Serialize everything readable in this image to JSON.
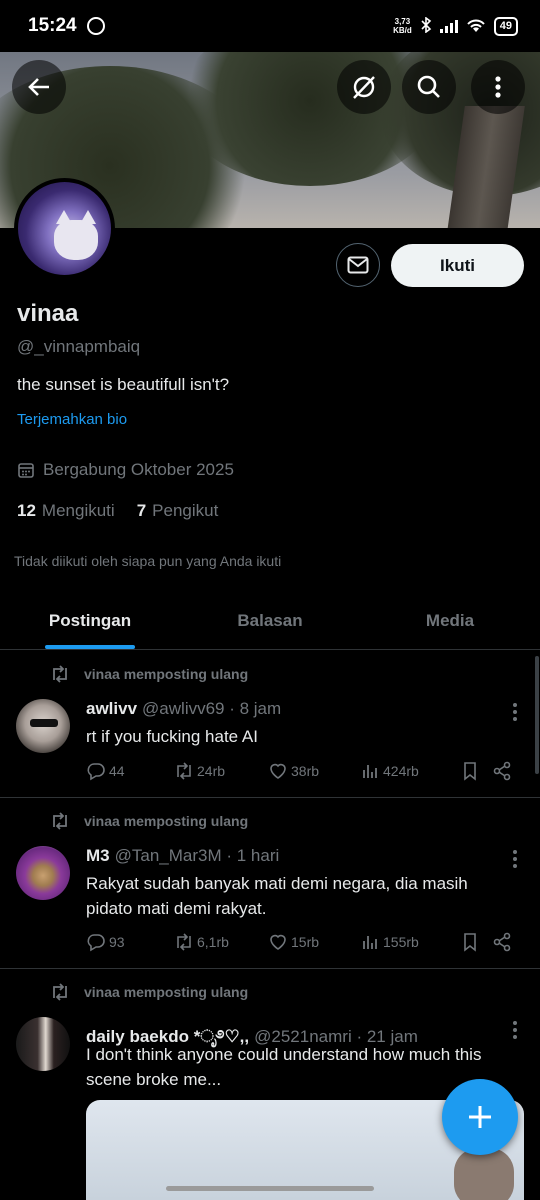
{
  "status_bar": {
    "time": "15:24",
    "speed_value": "3,73",
    "speed_unit": "KB/d",
    "battery": "49"
  },
  "profile": {
    "name": "vinaa",
    "handle": "@_vinnapmbaiq",
    "bio": "the sunset is beautifull isn't?",
    "translate_label": "Terjemahkan bio",
    "joined": "Bergabung Oktober 2025",
    "following_count": "12",
    "following_label": "Mengikuti",
    "followers_count": "7",
    "followers_label": "Pengikut",
    "not_followed_text": "Tidak diikuti oleh siapa pun yang Anda ikuti",
    "follow_button": "Ikuti"
  },
  "tabs": [
    {
      "label": "Postingan",
      "active": true
    },
    {
      "label": "Balasan",
      "active": false
    },
    {
      "label": "Media",
      "active": false
    }
  ],
  "posts": [
    {
      "repost_label": "vinaa memposting ulang",
      "name": "awlivv",
      "meta": "@awlivv69 · 8 jam",
      "text": "rt if you fucking hate AI",
      "replies": "44",
      "reposts": "24rb",
      "likes": "38rb",
      "views": "424rb"
    },
    {
      "repost_label": "vinaa memposting ulang",
      "name": "M3",
      "meta": "@Tan_Mar3M · 1 hari",
      "text": "Rakyat sudah banyak mati demi negara, dia masih pidato mati demi rakyat.",
      "replies": "93",
      "reposts": "6,1rb",
      "likes": "15rb",
      "views": "155rb"
    },
    {
      "repost_label": "vinaa memposting ulang",
      "name": "daily baekdo *ೃ࿔♡,,",
      "meta": "@2521namri · 21 jam",
      "text": "I don't think anyone could understand how much this scene broke me..."
    }
  ],
  "colors": {
    "accent": "#1d9bf0",
    "background": "#000000",
    "secondary_text": "#71767b"
  }
}
